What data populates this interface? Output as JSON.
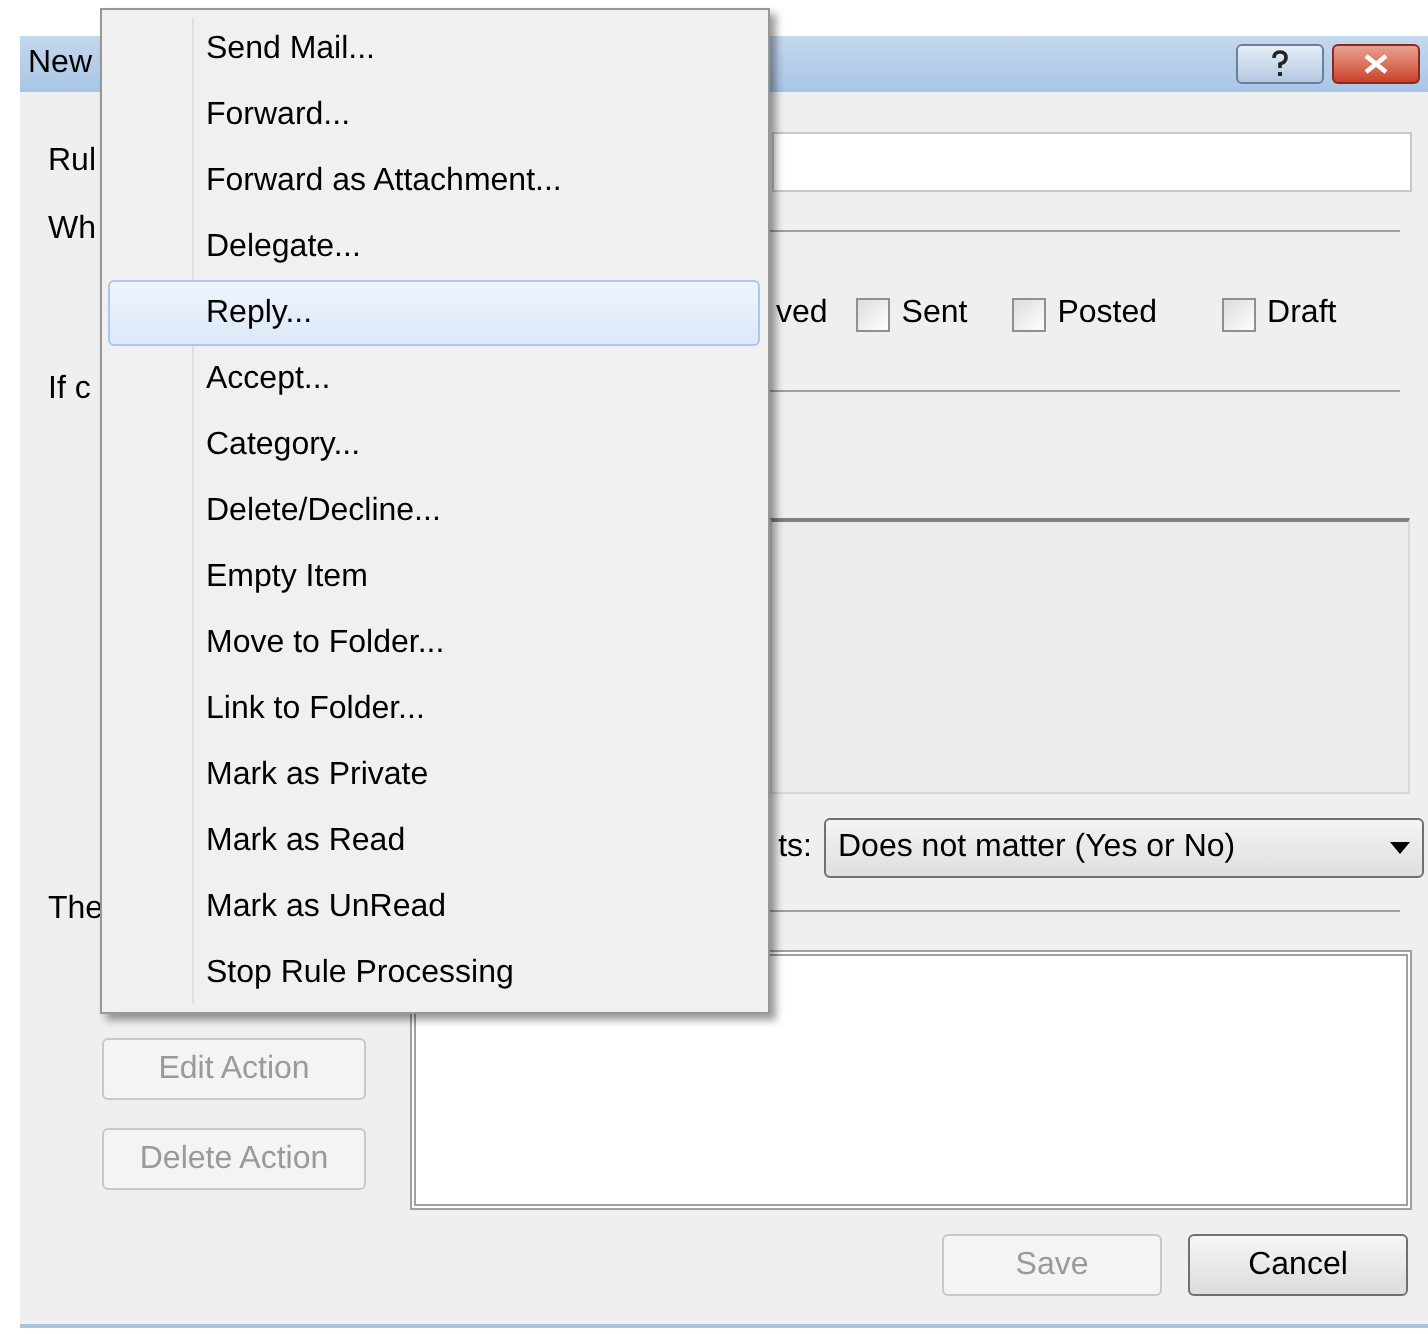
{
  "window": {
    "title": "New"
  },
  "rule_name": {
    "label": "Rul"
  },
  "when": {
    "label": "Wh",
    "hidden_label": "ved",
    "checkboxes": [
      {
        "label": "Sent",
        "checked": false
      },
      {
        "label": "Posted",
        "checked": false
      },
      {
        "label": "Draft",
        "checked": false
      }
    ]
  },
  "conditions": {
    "label": "If c",
    "dropdown_label": "ts:",
    "dropdown_value": "Does not matter (Yes or No)"
  },
  "actions": {
    "label": "The",
    "buttons": [
      {
        "label": "Edit Action",
        "disabled": true
      },
      {
        "label": "Delete Action",
        "disabled": true
      }
    ]
  },
  "footer_buttons": [
    {
      "label": "Save",
      "disabled": true
    },
    {
      "label": "Cancel",
      "disabled": false
    }
  ],
  "context_menu": {
    "items": [
      {
        "label": "Send Mail...",
        "selected": false
      },
      {
        "label": "Forward...",
        "selected": false
      },
      {
        "label": "Forward as Attachment...",
        "selected": false
      },
      {
        "label": "Delegate...",
        "selected": false
      },
      {
        "label": "Reply...",
        "selected": true
      },
      {
        "label": "Accept...",
        "selected": false
      },
      {
        "label": "Category...",
        "selected": false
      },
      {
        "label": "Delete/Decline...",
        "selected": false
      },
      {
        "label": "Empty Item",
        "selected": false
      },
      {
        "label": "Move to Folder...",
        "selected": false
      },
      {
        "label": "Link to Folder...",
        "selected": false
      },
      {
        "label": "Mark as Private",
        "selected": false
      },
      {
        "label": "Mark as Read",
        "selected": false
      },
      {
        "label": "Mark as UnRead",
        "selected": false
      },
      {
        "label": "Stop Rule Processing",
        "selected": false
      }
    ]
  }
}
